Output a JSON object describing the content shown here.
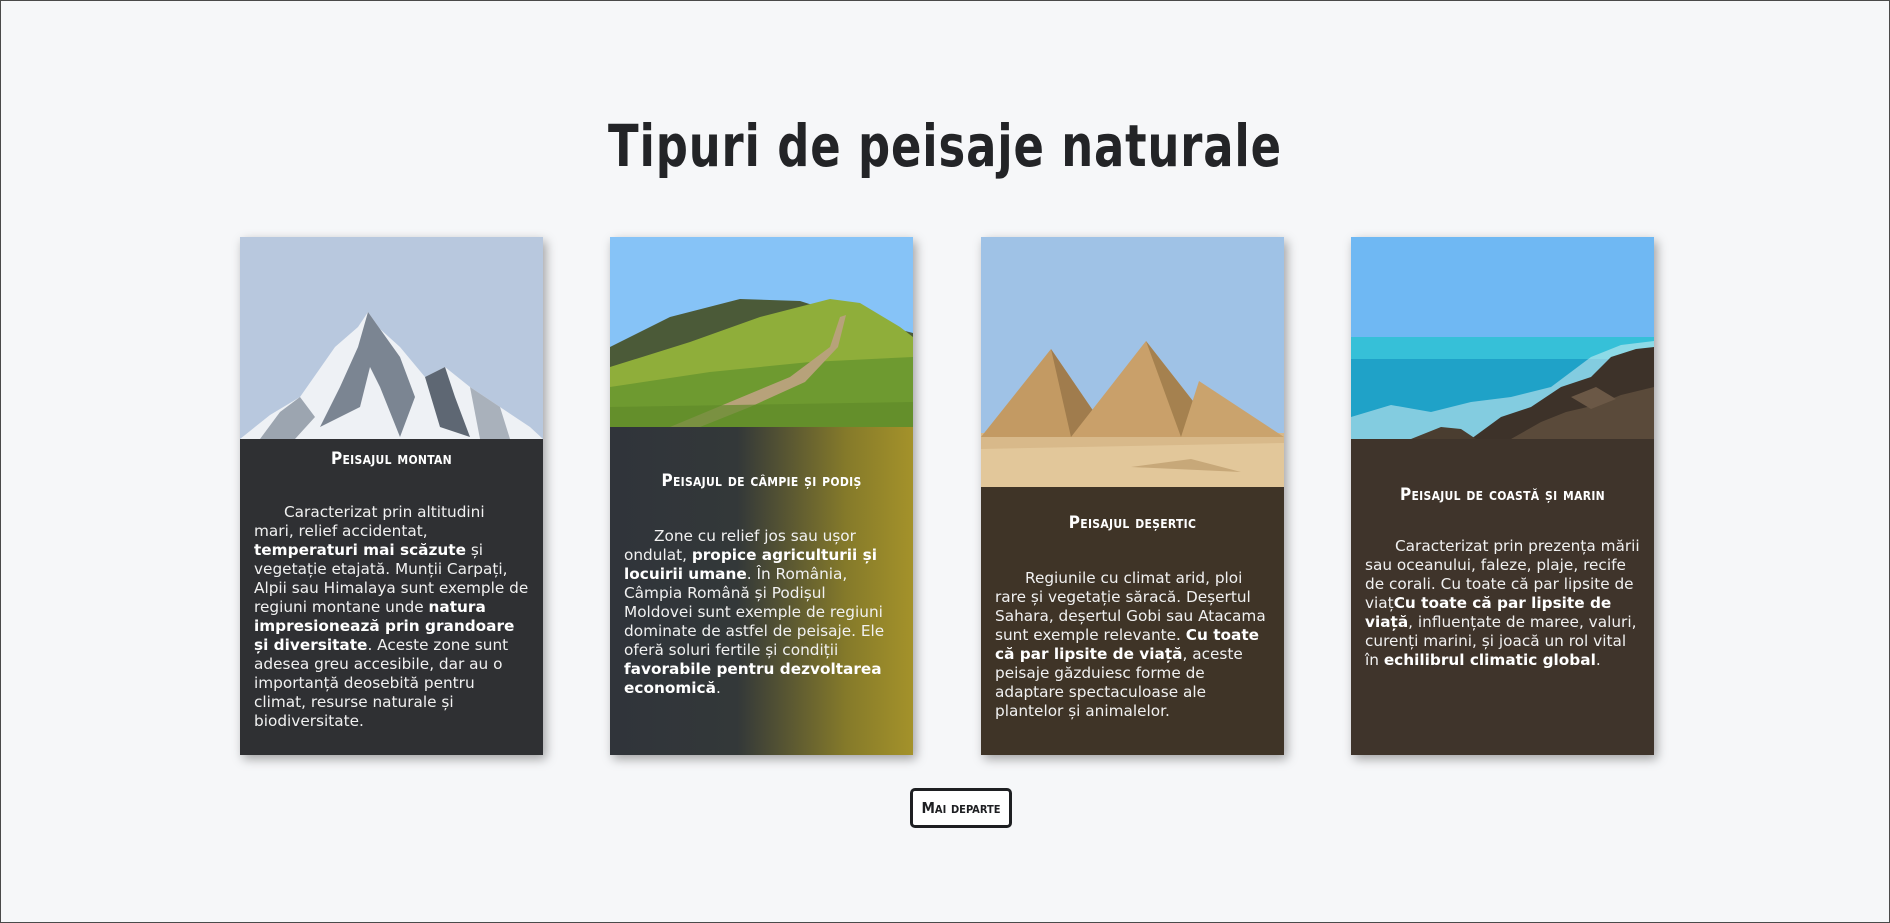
{
  "page": {
    "title": "Tipuri de peisaje naturale",
    "button_label": "Mai departe"
  },
  "cards": [
    {
      "title": "Peisajul montan",
      "image": "mountain-peak-image",
      "text": [
        {
          "t": "Caracterizat prin altitudini mari, relief accidentat, ",
          "bold": false
        },
        {
          "t": "temperaturi mai scăzute",
          "bold": true
        },
        {
          "t": " și vegetație etajată. Munții Carpați, Alpii sau Himalaya sunt exemple de regiuni montane unde ",
          "bold": false
        },
        {
          "t": "natura impresionează prin grandoare și diversitate",
          "bold": true
        },
        {
          "t": ". Aceste zone sunt adesea greu accesibile, dar au o importanță deosebită pentru climat, resurse naturale și biodiversitate.",
          "bold": false
        }
      ]
    },
    {
      "title": "Peisajul de câmpie și podiș",
      "image": "green-hills-image",
      "text": [
        {
          "t": "Zone cu relief jos sau ușor ondulat, ",
          "bold": false
        },
        {
          "t": "propice agriculturii și locuirii umane",
          "bold": true
        },
        {
          "t": ". În România, Câmpia Română și Podișul Moldovei sunt exemple de regiuni dominate de astfel de peisaje. Ele oferă soluri fertile și condiții ",
          "bold": false
        },
        {
          "t": "favorabile pentru dezvoltarea economică",
          "bold": true
        },
        {
          "t": ".",
          "bold": false
        }
      ]
    },
    {
      "title": "Peisajul deșertic",
      "image": "desert-pyramids-image",
      "text": [
        {
          "t": "Regiunile cu climat arid, ploi rare și vegetație săracă. Deșertul Sahara, deșertul Gobi sau Atacama sunt exemple relevante. ",
          "bold": false
        },
        {
          "t": "Cu toate că par lipsite de viață",
          "bold": true
        },
        {
          "t": ", aceste peisaje găzduiesc forme de adaptare spectaculoase ale plantelor și animalelor.",
          "bold": false
        }
      ]
    },
    {
      "title": "Peisajul de coastă și marin",
      "image": "rocky-coast-image",
      "text": [
        {
          "t": "Caracterizat prin prezența mării sau oceanului, faleze, plaje, recife de corali. Cu toate că par lipsite de viaț",
          "bold": false
        },
        {
          "t": "Cu toate că par lipsite de viață",
          "bold": true
        },
        {
          "t": ", influențate de maree, valuri, curenți marini, și joacă un rol vital în ",
          "bold": false
        },
        {
          "t": "echilibrul climatic global",
          "bold": true
        },
        {
          "t": ".",
          "bold": false
        }
      ]
    }
  ],
  "colors": {
    "background": "#f6f7f9",
    "card_dark": "#2f3033",
    "card_brown": "#3f342b",
    "gradient_olive": "#a4922a",
    "title_text": "#232427"
  }
}
